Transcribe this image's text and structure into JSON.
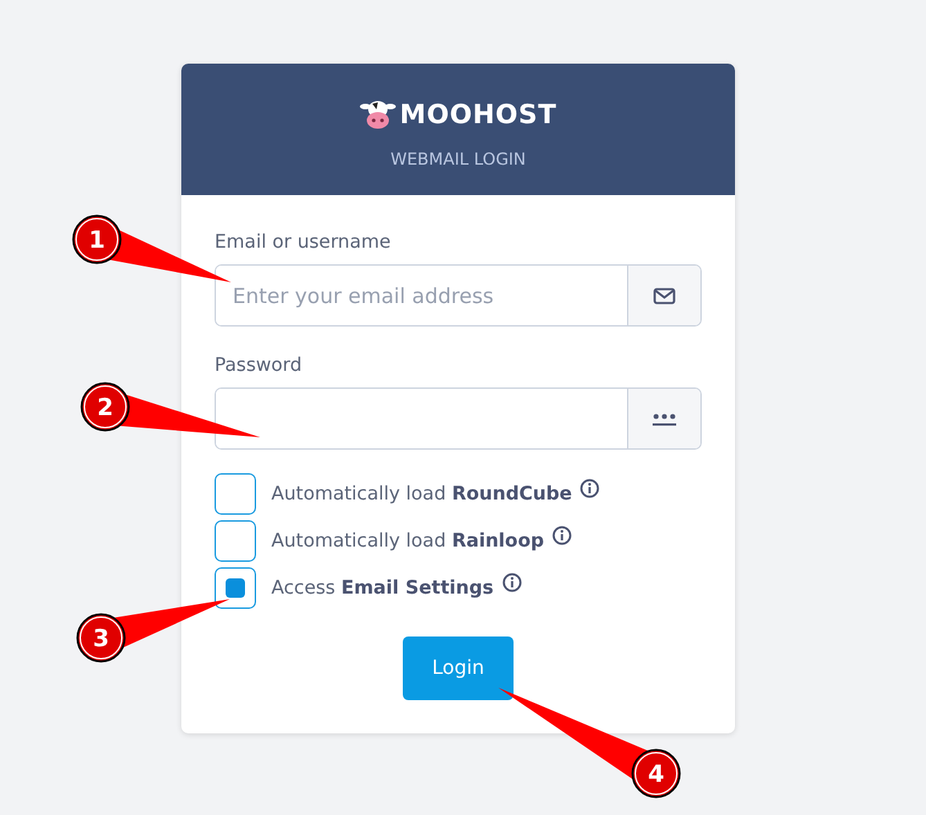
{
  "header": {
    "brand": "MOOHOST",
    "subtitle": "WEBMAIL LOGIN"
  },
  "fields": [
    {
      "label": "Email or username",
      "placeholder": "Enter your email address",
      "kind": "email"
    },
    {
      "label": "Password",
      "kind": "password"
    }
  ],
  "options": [
    {
      "text": "Automatically load **RoundCube**",
      "checked": false
    },
    {
      "text": "Automatically load **Rainloop**",
      "checked": false
    },
    {
      "text": "Access **Email Settings**",
      "checked": true
    }
  ],
  "login_button": "Login",
  "callouts": [
    {
      "number": "1"
    },
    {
      "number": "2"
    },
    {
      "number": "3"
    },
    {
      "number": "4"
    }
  ]
}
